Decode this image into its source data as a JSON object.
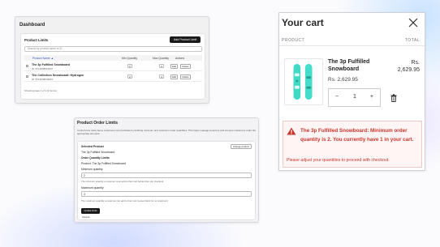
{
  "dashboard": {
    "title": "Dashboard",
    "section_title": "Product Limits",
    "add_button": "Add Product Limit",
    "search_placeholder": "Search by product name or ID",
    "columns": {
      "name": "Product Name ▲",
      "min": "Min Quantity",
      "max": "Max Quantity",
      "actions": "Actions"
    },
    "rows": [
      {
        "name": "The 3p Fulfilled Snowboard",
        "id": "ID: 8713838616837",
        "min": "2",
        "max": "3",
        "edit": "Edit",
        "delete": "Delete"
      },
      {
        "name": "The Collection Snowboard: Hydrogen",
        "id": "ID: 8713838649597",
        "min": "2",
        "max": "4",
        "edit": "Edit",
        "delete": "Delete"
      }
    ],
    "pager": "Showing page 1 of 1 (2 items)"
  },
  "limits": {
    "title": "Product Order Limits",
    "description": "Control how many items customers can purchase by defining minimum and maximum order quantities. This helps manage inventory and ensures customers order the appropriate amounts.",
    "selected_label": "Selected Product",
    "change_button": "Change product",
    "selected_value": "The 3p Fulfilled Snowboard",
    "settings_label": "Order Quantity Limits",
    "product_line": "Product: The 3p Fulfilled Snowboard",
    "min_label": "Minimum quantity",
    "min_value": "2",
    "min_help": "The minimum quantity a customer must add to their cart before they can checkout",
    "max_label": "Maximum quantity",
    "max_value": "3",
    "max_help": "The maximum quantity a customer can add to their cart (Leave blank for no maximum)",
    "update_button": "Update limits",
    "cancel": "Cancel"
  },
  "cart": {
    "title": "Your cart",
    "close_icon": "close-icon",
    "col_product": "PRODUCT",
    "col_total": "TOTAL",
    "product_name": "The 3p Fulfilled Snowboard",
    "total_currency": "Rs.",
    "total_amount": "2,629.95",
    "unit_price": "Rs. 2,629.95",
    "minus": "−",
    "quantity": "1",
    "plus": "+",
    "trash_icon": "trash-icon",
    "error_main": "The 3p Fulfilled Snowboard: Minimum order quantity is 2. You currently have 1 in your cart.",
    "error_sub": "Please adjust your quantities to proceed with checkout.",
    "error_color": "#c7342b",
    "board_color": "#3fd9c6"
  }
}
